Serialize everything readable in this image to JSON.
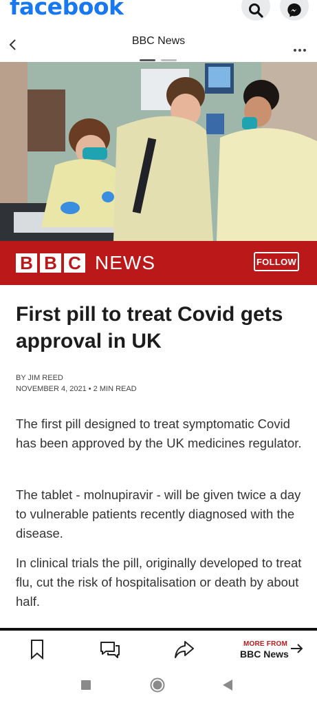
{
  "facebook": {
    "logo_text": "facebook",
    "search_icon": "search-icon",
    "messenger_icon": "messenger-icon"
  },
  "header": {
    "title": "BBC News",
    "back_icon": "chevron-left-icon",
    "more_icon": "more-dots-icon"
  },
  "banner": {
    "letters": [
      "B",
      "B",
      "C"
    ],
    "news_label": "NEWS",
    "follow_label": "FOLLOW",
    "color": "#bb1919"
  },
  "article": {
    "headline": "First pill to treat Covid gets approval in UK",
    "byline": "BY JIM REED",
    "dateline": "NOVEMBER 4, 2021 • 2 MIN READ",
    "paragraphs": [
      "The first pill designed to treat symptomatic Covid has been approved by the UK medicines regulator.",
      "The tablet - molnupiravir - will be given twice a day to vulnerable patients recently diagnosed with the disease.",
      "In clinical trials the pill, originally developed to treat flu, cut the risk of hospitalisation or death by about half."
    ]
  },
  "toolbar": {
    "save_icon": "bookmark-icon",
    "comment_icon": "comment-icon",
    "share_icon": "share-icon",
    "more_from_label": "MORE FROM",
    "more_from_source": "BBC News",
    "arrow_icon": "arrow-right-icon"
  },
  "system_nav": {
    "recents_icon": "square-icon",
    "home_icon": "circle-icon",
    "back_icon": "triangle-back-icon"
  }
}
